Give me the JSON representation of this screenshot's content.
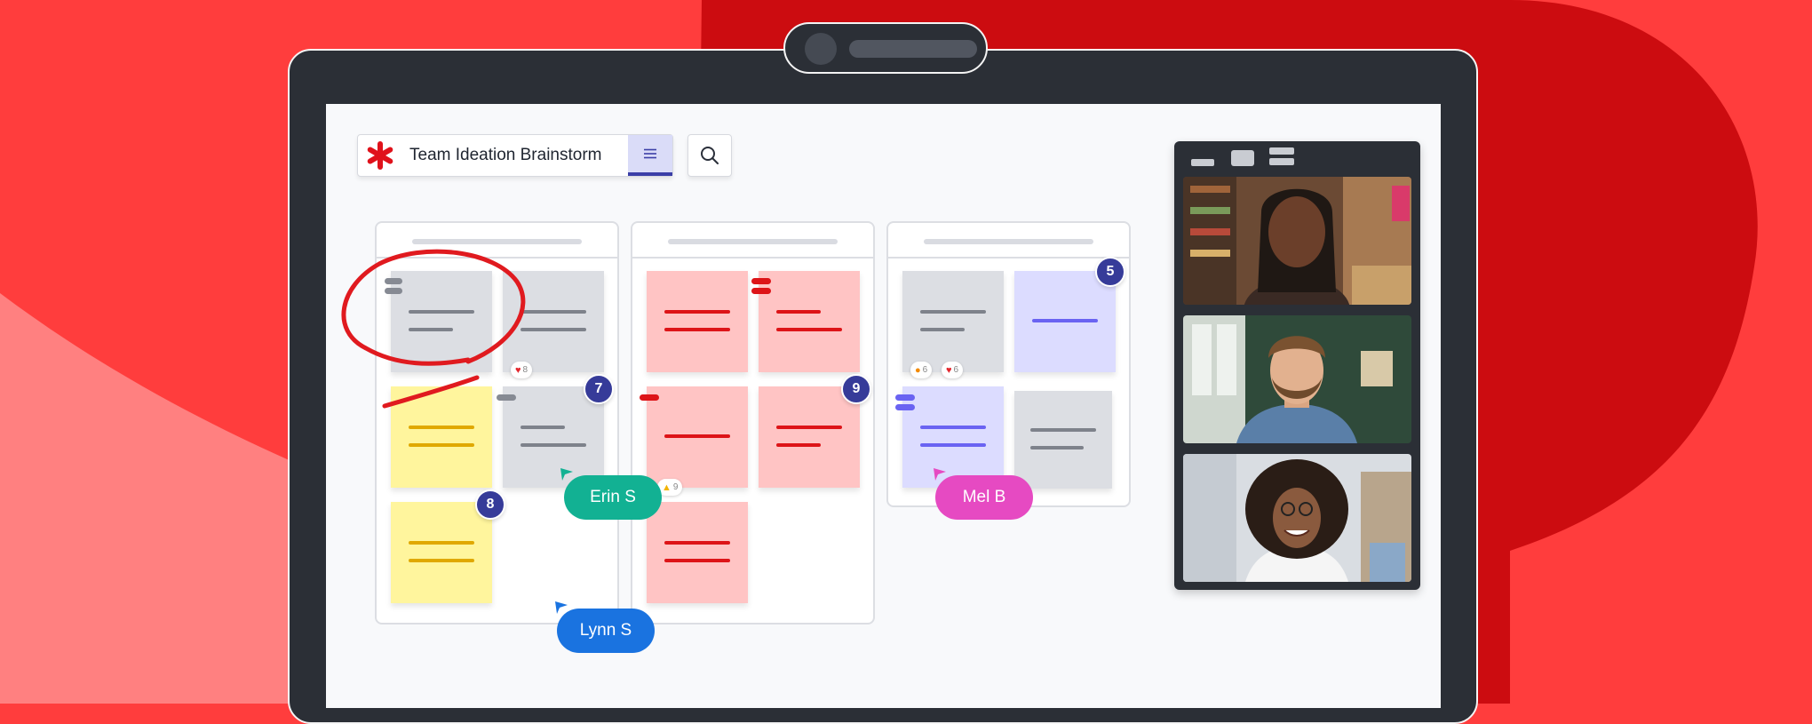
{
  "board": {
    "title": "Team Ideation Brainstorm",
    "logo_icon": "asterisk-logo-icon",
    "menu_icon": "hamburger-menu-icon",
    "search_icon": "search-icon"
  },
  "badges": [
    "7",
    "8",
    "9",
    "5"
  ],
  "reactions": [
    {
      "icon": "heart",
      "count": "8"
    },
    {
      "icon": "thumbs-up",
      "count": "9"
    },
    {
      "icon": "fire",
      "count": "6"
    },
    {
      "icon": "heart",
      "count": "6"
    }
  ],
  "collaborators": [
    {
      "name": "Erin S",
      "color": "#12b193"
    },
    {
      "name": "Lynn S",
      "color": "#1a73e0"
    },
    {
      "name": "Mel B",
      "color": "#e64ac2"
    }
  ],
  "colors": {
    "background": "#ff3d3d",
    "accent": "#363b99",
    "note_gray": "#dcdee3",
    "note_yellow": "#fff59d",
    "note_pink": "#ffc4c4",
    "note_lavender": "#dcdcff"
  }
}
